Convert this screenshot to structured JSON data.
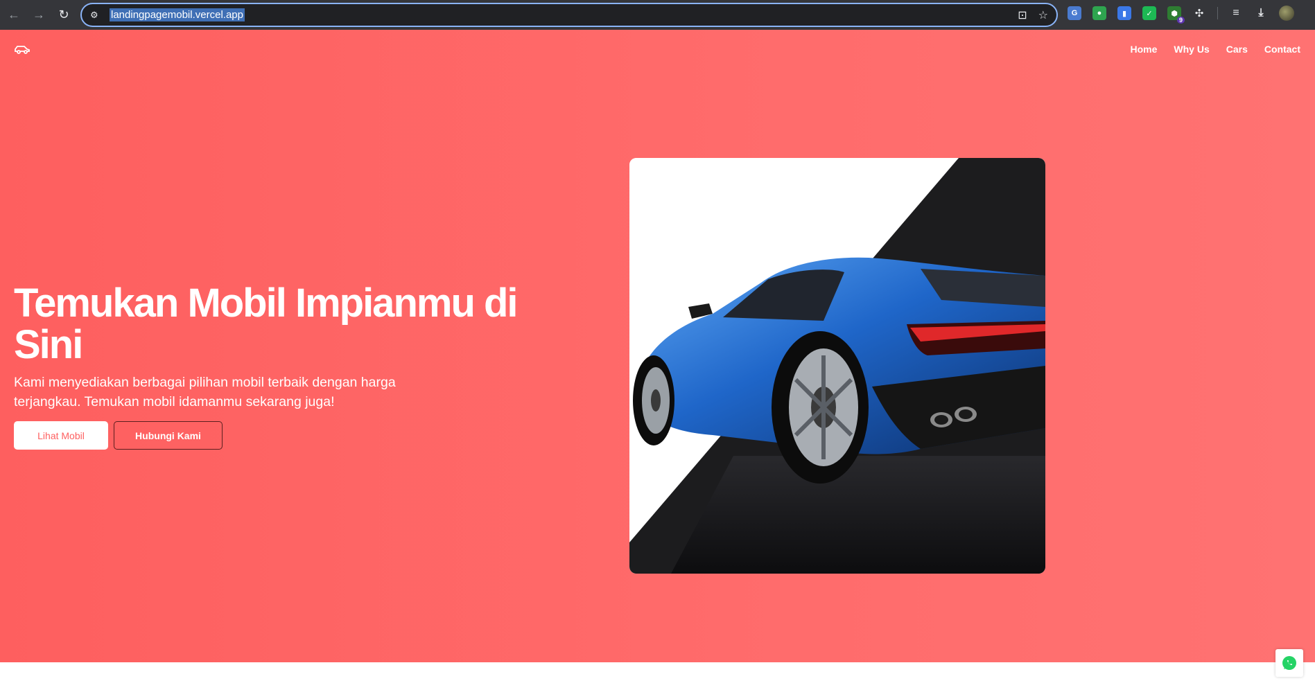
{
  "browser": {
    "url": "landingpagemobil.vercel.app",
    "extensions": [
      {
        "name": "translate-extension",
        "color": "#4a7bd0",
        "glyph": "G"
      },
      {
        "name": "color-extension",
        "color": "#2ea44f",
        "glyph": "●"
      },
      {
        "name": "docs-extension",
        "color": "#3b78e7",
        "glyph": "▮"
      },
      {
        "name": "check-extension",
        "color": "#1db954",
        "glyph": "✓"
      },
      {
        "name": "shield-extension",
        "color": "#2e7d32",
        "glyph": "⬢",
        "badge": "9"
      }
    ]
  },
  "nav": {
    "logo_icon": "car-icon",
    "links": [
      "Home",
      "Why Us",
      "Cars",
      "Contact"
    ]
  },
  "hero": {
    "title": "Temukan Mobil Impianmu di Sini",
    "description": "Kami menyediakan berbagai pilihan mobil terbaik dengan harga terjangkau. Temukan mobil idamanmu sekarang juga!",
    "primary_button": "Lihat Mobil",
    "secondary_button": "Hubungi Kami",
    "background_color": "#ff6b6b",
    "image_alt": "blue sports car"
  },
  "floating": {
    "whatsapp_icon": "whatsapp-icon",
    "color": "#25d366"
  }
}
